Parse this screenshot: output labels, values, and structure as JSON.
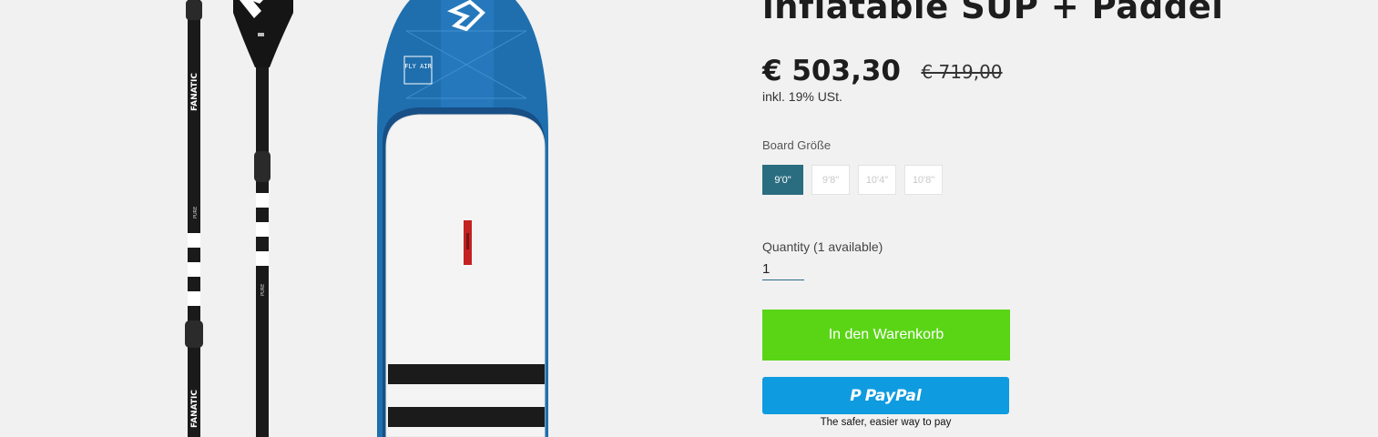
{
  "product": {
    "title": "inflatable SUP + Paddel",
    "price": "€ 503,30",
    "compare_price": "€ 719,00",
    "tax_note": "inkl. 19% USt."
  },
  "variants": {
    "label": "Board Größe",
    "options": [
      "9'0\"",
      "9'8\"",
      "10'4\"",
      "10'8\""
    ],
    "selected": "9'0\""
  },
  "quantity": {
    "label": "Quantity (1 available)",
    "value": "1"
  },
  "buttons": {
    "add_to_cart": "In den Warenkorb",
    "paypal_icon": "P",
    "paypal_label": "PayPal",
    "paypal_tagline": "The safer, easier way to pay"
  },
  "images": {
    "paddle_brand": "FANATIC",
    "paddle_model": "PURE",
    "board_logo": "FLY AIR"
  },
  "colors": {
    "accent": "#2b6d80",
    "cart_green": "#5ad516",
    "paypal_blue": "#0f9be0",
    "board_blue": "#1f6fae"
  }
}
